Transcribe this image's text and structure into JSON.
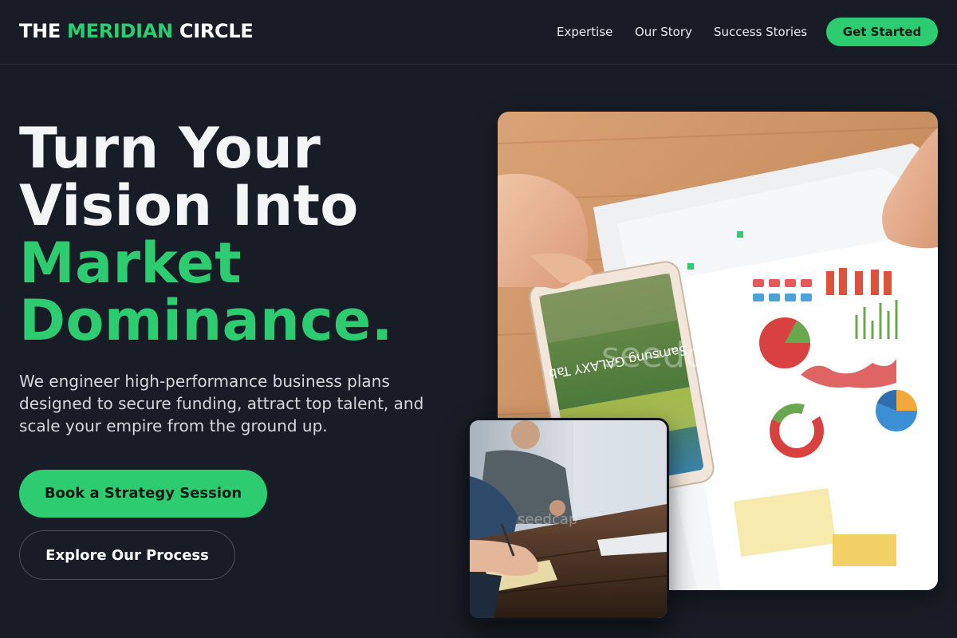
{
  "brand": {
    "name_part1": "THE ",
    "name_accent": "MERIDIAN",
    "name_part2": " CIRCLE",
    "accent_color": "#2ecc71"
  },
  "nav": {
    "links": [
      "Expertise",
      "Our Story",
      "Success Stories"
    ],
    "cta_label": "Get Started"
  },
  "hero": {
    "headline_line1": "Turn Your",
    "headline_line2": "Vision Into",
    "headline_line3": "Market",
    "headline_line4": "Dominance.",
    "subtext": "We engineer high-performance business plans designed to secure funding, attract top talent, and scale your empire from the ground up.",
    "primary_button": "Book a Strategy Session",
    "secondary_button": "Explore Our Process"
  },
  "images": {
    "main_alt": "Hands reviewing printed business charts and a tablet on a wooden desk",
    "small_alt": "Team meeting around a wooden table with notebooks and laptop",
    "watermark": "seedcap",
    "device_label": "Samsung GALAXY Tab"
  },
  "colors": {
    "background": "#171c26",
    "accent": "#2ecc71",
    "text": "#ffffff",
    "muted_text": "#d4d8df"
  }
}
